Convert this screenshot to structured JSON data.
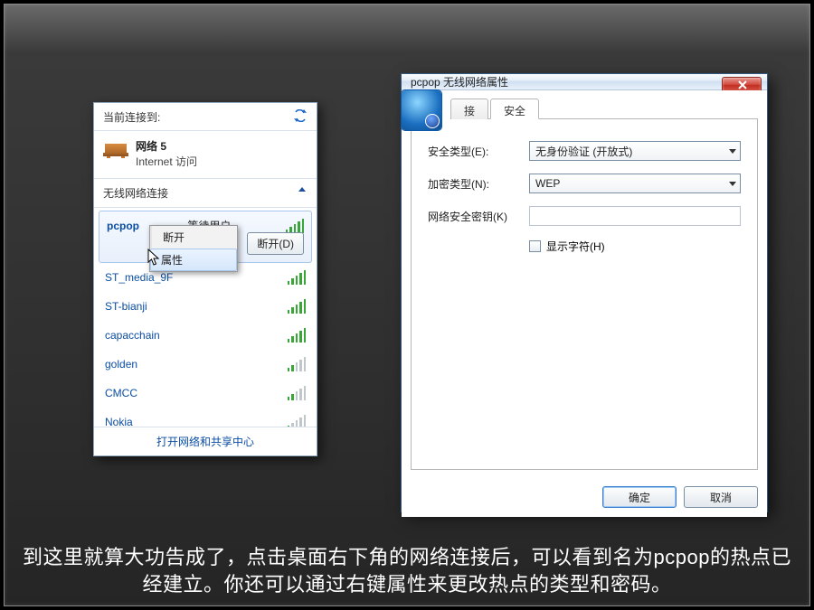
{
  "net_panel": {
    "title": "当前连接到:",
    "current": {
      "name": "网络  5",
      "status": "Internet 访问"
    },
    "section": "无线网络连接",
    "selected": {
      "name": "pcpop",
      "status": "等待用户",
      "disconnect_btn": "断开(D)"
    },
    "context_menu": {
      "disconnect": "断开",
      "properties": "属性"
    },
    "items": [
      {
        "name": "ST_media_9F",
        "signal": "strong"
      },
      {
        "name": "ST-bianji",
        "signal": "strong"
      },
      {
        "name": "capacchain",
        "signal": "strong"
      },
      {
        "name": "golden",
        "signal": "weak"
      },
      {
        "name": "CMCC",
        "signal": "weak"
      },
      {
        "name": "Nokia",
        "signal": "weak"
      }
    ],
    "footer": "打开网络和共享中心"
  },
  "dialog": {
    "title": "pcpop 无线网络属性",
    "tabs": {
      "connect": "接",
      "security": "安全"
    },
    "labels": {
      "sec_type": "安全类型(E):",
      "enc_type": "加密类型(N):",
      "key": "网络安全密钥(K)",
      "show": "显示字符(H)"
    },
    "values": {
      "sec_type": "无身份验证 (开放式)",
      "enc_type": "WEP",
      "key": ""
    },
    "buttons": {
      "ok": "确定",
      "cancel": "取消"
    }
  },
  "caption": "到这里就算大功告成了，点击桌面右下角的网络连接后，可以看到名为pcpop的热点已经建立。你还可以通过右键属性来更改热点的类型和密码。"
}
